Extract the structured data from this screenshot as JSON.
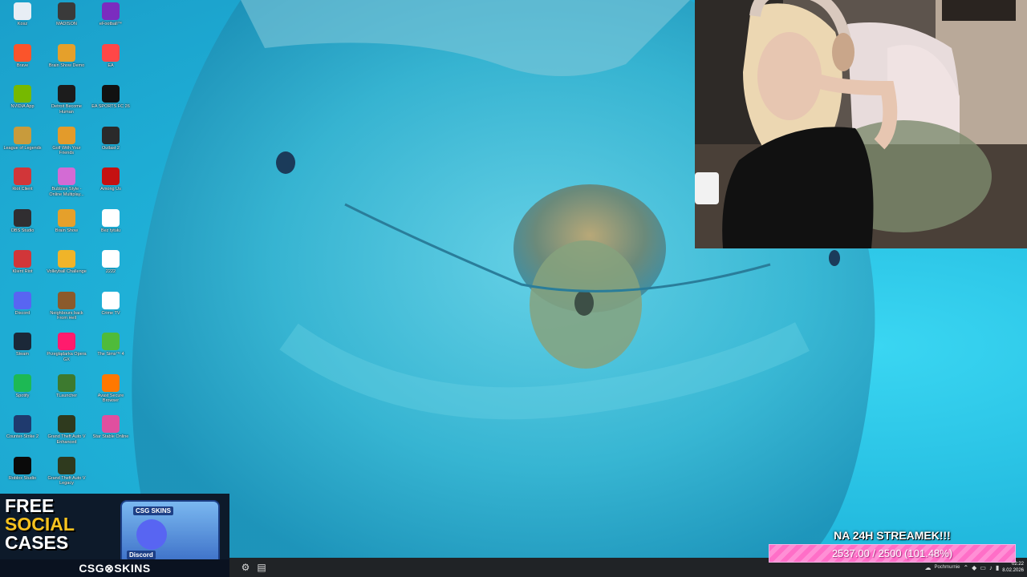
{
  "desktop": {
    "icons": [
      {
        "label": "Kosz",
        "icon": "recycle-bin-icon",
        "color": "#e8eef5"
      },
      {
        "label": "MADISON",
        "icon": "madison-icon",
        "color": "#3a3a3a"
      },
      {
        "label": "eFootball™",
        "icon": "efootball-icon",
        "color": "#7b2cbf"
      },
      {
        "label": "Brave",
        "icon": "brave-icon",
        "color": "#fb542b"
      },
      {
        "label": "Brain Show Demo",
        "icon": "brain-show-icon",
        "color": "#e5a02b"
      },
      {
        "label": "EA",
        "icon": "ea-icon",
        "color": "#ff4747"
      },
      {
        "label": "NVIDIA App",
        "icon": "nvidia-icon",
        "color": "#76b900"
      },
      {
        "label": "Detroit Become Human",
        "icon": "detroit-icon",
        "color": "#1c1c1c"
      },
      {
        "label": "EA SPORTS FC 26",
        "icon": "eafc-icon",
        "color": "#111111"
      },
      {
        "label": "League of Legends",
        "icon": "lol-icon",
        "color": "#c89b3c"
      },
      {
        "label": "Golf With Your Friends",
        "icon": "golf-icon",
        "color": "#e39b2b"
      },
      {
        "label": "Outlast 2",
        "icon": "outlast-icon",
        "color": "#2a2a2a"
      },
      {
        "label": "Riot Client",
        "icon": "riot-icon",
        "color": "#d13639"
      },
      {
        "label": "Bubbles Style - Online Multiplay...",
        "icon": "bubbles-icon",
        "color": "#d36bd4"
      },
      {
        "label": "Among Us",
        "icon": "among-us-icon",
        "color": "#c51111"
      },
      {
        "label": "OBS Studio",
        "icon": "obs-icon",
        "color": "#302e31"
      },
      {
        "label": "Brain Show",
        "icon": "brain-show-icon",
        "color": "#e5a02b"
      },
      {
        "label": "Bez tytułu",
        "icon": "file-icon",
        "color": "#ffffff"
      },
      {
        "label": "Klient Riot",
        "icon": "riot-icon",
        "color": "#d13639"
      },
      {
        "label": "Volleyball Challenge",
        "icon": "volleyball-icon",
        "color": "#f0b429"
      },
      {
        "label": "2222",
        "icon": "document-icon",
        "color": "#ffffff"
      },
      {
        "label": "Discord",
        "icon": "discord-icon",
        "color": "#5865f2"
      },
      {
        "label": "Neighbours back From Hell",
        "icon": "neighbours-icon",
        "color": "#8b5a2b"
      },
      {
        "label": "Crime TV",
        "icon": "crime-tv-icon",
        "color": "#ffffff"
      },
      {
        "label": "Steam",
        "icon": "steam-icon",
        "color": "#1b2838"
      },
      {
        "label": "Przeglądarka Opera GX",
        "icon": "opera-gx-icon",
        "color": "#ff1b6d"
      },
      {
        "label": "The Sims™ 4",
        "icon": "sims-icon",
        "color": "#4fbb3a"
      },
      {
        "label": "Spotify",
        "icon": "spotify-icon",
        "color": "#1db954"
      },
      {
        "label": "TLauncher",
        "icon": "tlauncher-icon",
        "color": "#3d7a2f"
      },
      {
        "label": "Avast Secure Browser",
        "icon": "avast-icon",
        "color": "#ff7800"
      },
      {
        "label": "Counter-Strike 2",
        "icon": "cs2-icon",
        "color": "#1f3a6e"
      },
      {
        "label": "Grand Theft Auto V Enhanced",
        "icon": "gta-icon",
        "color": "#2f3a1e"
      },
      {
        "label": "Star Stable Online",
        "icon": "star-stable-icon",
        "color": "#e04f9f"
      },
      {
        "label": "Roblox Studio",
        "icon": "roblox-icon",
        "color": "#0a0a0a"
      },
      {
        "label": "Grand Theft Auto V Legacy",
        "icon": "gta-icon",
        "color": "#2f3a1e"
      }
    ]
  },
  "promo": {
    "line1": "FREE",
    "line2": "SOCIAL",
    "line3": "CASES",
    "case_tag": "CSG SKINS",
    "case_bottom": "Discord",
    "brand": "CSG⊗SKINS"
  },
  "goal": {
    "title": "NA 24H STREAMEK!!!",
    "progress_text": "2537.00 / 2500 (101.48%)",
    "progress_fraction": 1.0148,
    "bar_color": "#ff6ec7"
  },
  "taskbar": {
    "tray_label": "Pochmurnie",
    "time": "02:22",
    "date": "8.02.2026"
  }
}
